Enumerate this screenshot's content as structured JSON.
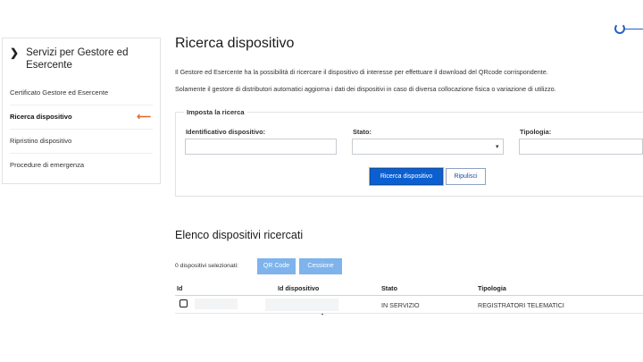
{
  "sidebar": {
    "title": "Servizi per Gestore ed Esercente",
    "chevron": "❯",
    "items": [
      {
        "label": "Certificato Gestore ed Esercente",
        "active": false
      },
      {
        "label": "Ricerca dispositivo",
        "active": true
      },
      {
        "label": "Ripristino dispositivo",
        "active": false
      },
      {
        "label": "Procedure di emergenza",
        "active": false
      }
    ],
    "active_arrow": "⟵"
  },
  "page": {
    "title": "Ricerca dispositivo",
    "intro_line1": "Il Gestore ed Esercente ha la possibilità di ricercare il dispositivo di interesse per effettuare il download del QRcode corrispondente.",
    "intro_line2": "Solamente il gestore di distributori automatici aggiorna i dati dei dispositivi in caso di diversa collocazione fisica o variazione di utilizzo."
  },
  "search": {
    "legend": "Imposta la ricerca",
    "id_label": "Identificativo dispositivo:",
    "id_value": "",
    "stato_label": "Stato:",
    "stato_value": "",
    "tipologia_label": "Tipologia:",
    "tipologia_value": "",
    "search_button": "Ricerca dispositivo",
    "reset_button": "Ripulisci"
  },
  "results": {
    "title": "Elenco dispositivi ricercati",
    "selected_count": "0 dispositivi selezionati:",
    "qr_button": "QR Code",
    "cessione_button": "Cessione",
    "columns": [
      "Id",
      "Id dispositivo",
      "Stato",
      "Tipologia"
    ],
    "rows": [
      {
        "stato": "IN SERVIZIO",
        "tipologia": "REGISTRATORI TELEMATICI"
      }
    ]
  },
  "colors": {
    "primary": "#0b5fd1",
    "accent_arrow": "#e1682b",
    "light_button": "#7eb3ec"
  }
}
